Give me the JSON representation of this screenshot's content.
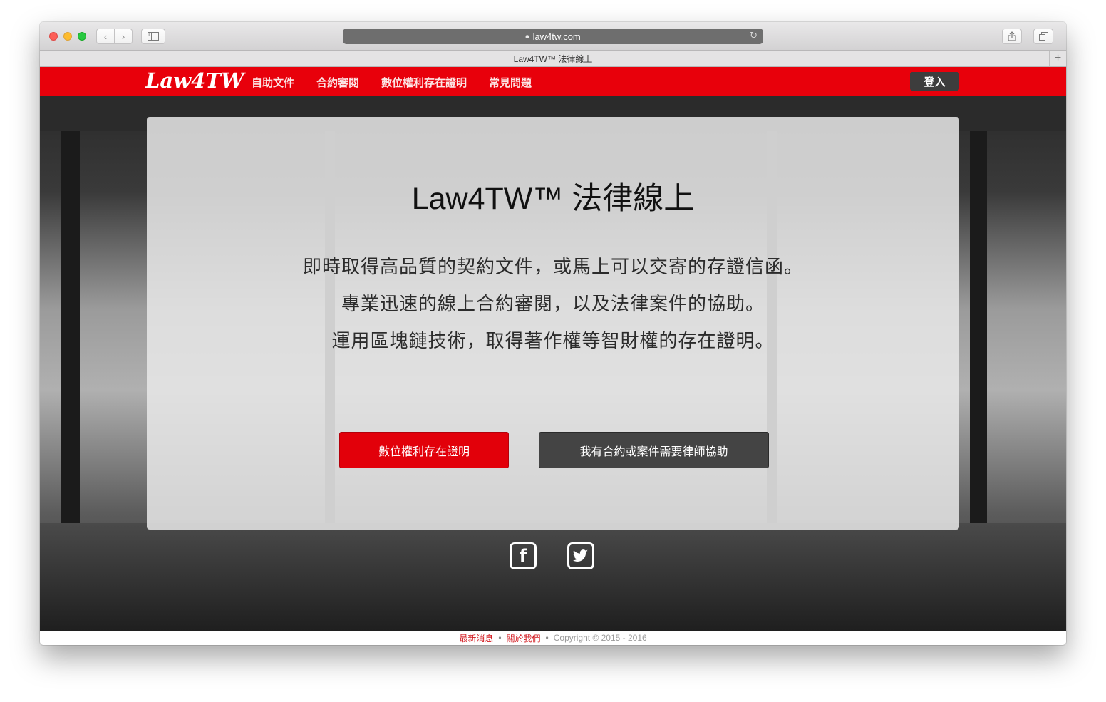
{
  "browser": {
    "url": "law4tw.com",
    "tab_title": "Law4TW™ 法律線上",
    "icons": {
      "back": "chevron-left-icon",
      "forward": "chevron-right-icon",
      "sidebar": "sidebar-icon",
      "lock": "lock-icon",
      "reload": "reload-icon",
      "share": "share-icon",
      "tabs": "tabs-overview-icon",
      "new_tab": "plus-icon"
    }
  },
  "navbar": {
    "logo": "Law4TW",
    "links": [
      "自助文件",
      "合約審閱",
      "數位權利存在證明",
      "常見問題"
    ],
    "login": "登入",
    "color": "#e8000b"
  },
  "hero": {
    "title": "Law4TW™ 法律線上",
    "lines": [
      "即時取得高品質的契約文件，或馬上可以交寄的存證信函。",
      "專業迅速的線上合約審閱，以及法律案件的協助。",
      "運用區塊鏈技術，取得著作權等智財權的存在證明。"
    ],
    "primary_button": "數位權利存在證明",
    "secondary_button": "我有合約或案件需要律師協助",
    "social": [
      "facebook-icon",
      "twitter-icon"
    ]
  },
  "footer": {
    "news": "最新消息",
    "about": "關於我們",
    "copyright": "Copyright © 2015 - 2016"
  }
}
